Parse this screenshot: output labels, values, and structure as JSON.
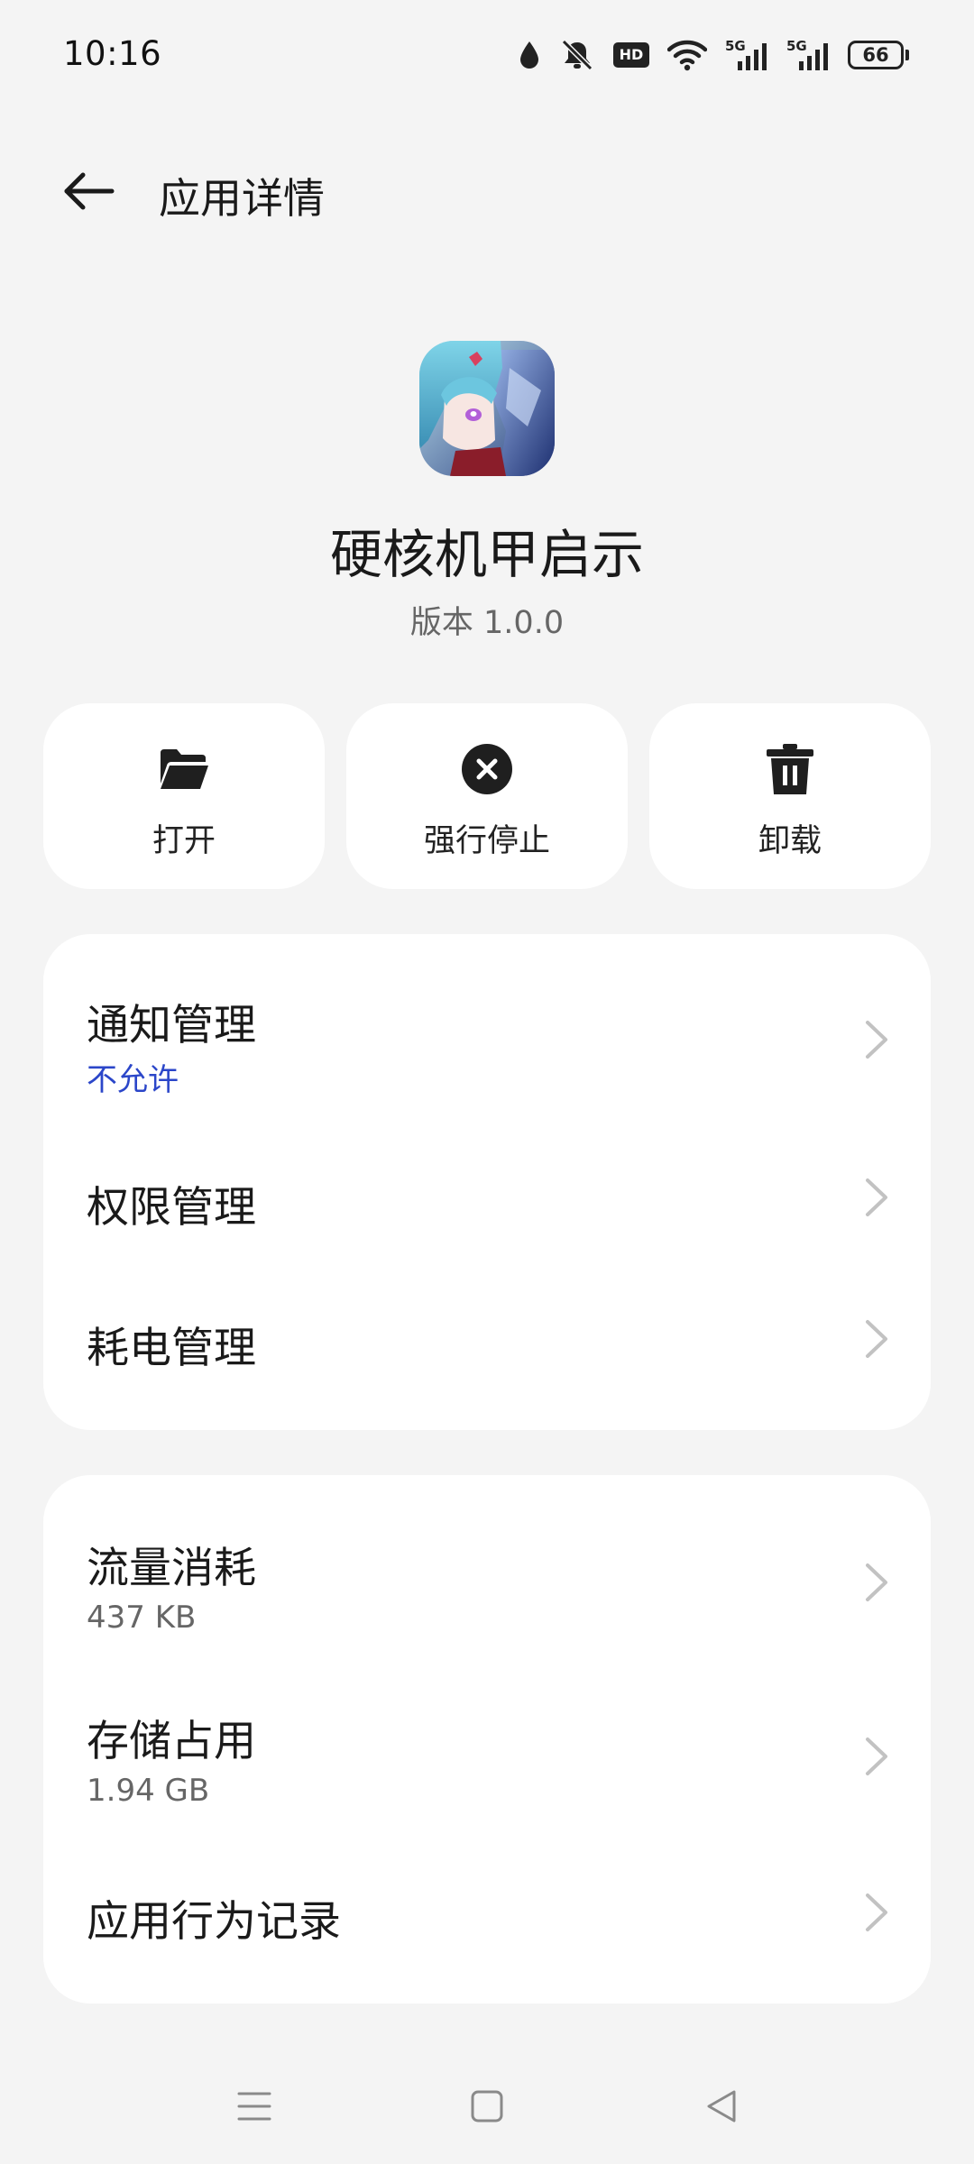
{
  "status_bar": {
    "time": "10:16",
    "battery": "66",
    "hd_label": "HD",
    "net1_label": "5G",
    "net2_label": "5G",
    "icons": [
      "water-drop-icon",
      "bell-muted-icon",
      "hd-icon",
      "wifi-icon",
      "signal-5g-icon",
      "signal-5g-icon",
      "battery-icon"
    ]
  },
  "header": {
    "title": "应用详情",
    "back_icon": "arrow-left-icon"
  },
  "app": {
    "name": "硬核机甲启示",
    "version": "版本 1.0.0"
  },
  "actions": [
    {
      "label": "打开",
      "icon": "folder-open-icon"
    },
    {
      "label": "强行停止",
      "icon": "close-circle-icon"
    },
    {
      "label": "卸载",
      "icon": "trash-icon"
    }
  ],
  "management": {
    "items": [
      {
        "title": "通知管理",
        "subtitle": "不允许"
      },
      {
        "title": "权限管理"
      },
      {
        "title": "耗电管理"
      }
    ]
  },
  "usage": {
    "items": [
      {
        "title": "流量消耗",
        "subtitle": "437 KB"
      },
      {
        "title": "存储占用",
        "subtitle": "1.94 GB"
      },
      {
        "title": "应用行为记录"
      }
    ]
  },
  "colors": {
    "background": "#f4f4f4",
    "card": "#ffffff",
    "accent_blue": "#2b46c9",
    "text_primary": "#1a1a1a",
    "text_secondary": "#666666"
  },
  "nav_bar": {
    "buttons": [
      "menu-icon",
      "home-square-icon",
      "back-triangle-icon"
    ]
  }
}
